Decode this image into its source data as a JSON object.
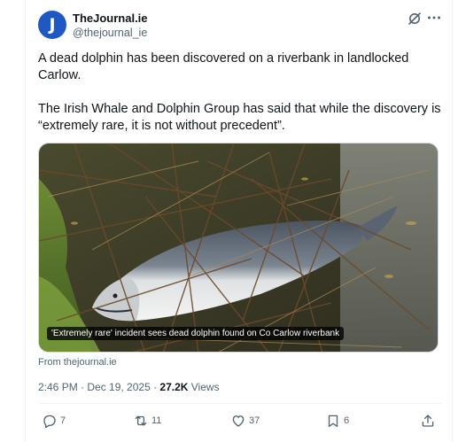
{
  "author": {
    "avatar_letter": "J",
    "name": "TheJournal.ie",
    "handle": "@thejournal_ie"
  },
  "icons": {
    "grok": "grok-icon",
    "more": "more-icon",
    "reply": "reply-icon",
    "repost": "repost-icon",
    "like": "like-icon",
    "bookmark": "bookmark-icon",
    "share": "share-icon"
  },
  "post": {
    "paragraph1": "A dead dolphin has been discovered on a riverbank in landlocked Carlow.",
    "paragraph2": "The Irish Whale and Dolphin Group has said that while the discovery is “extremely rare, it is not without precedent”."
  },
  "card": {
    "caption": "'Extremely rare' incident sees dead dolphin found on Co Carlow riverbank",
    "source": "From thejournal.ie"
  },
  "meta": {
    "time_date": "2:46 PM · Dec 19, 2025 · ",
    "views_count": "27.2K",
    "views_label": " Views"
  },
  "stats": {
    "replies": "7",
    "reposts": "11",
    "likes": "37",
    "bookmarks": "6"
  },
  "colors": {
    "avatar_bg": "#1f57c3",
    "text_primary": "#0f1419",
    "text_secondary": "#536471"
  }
}
